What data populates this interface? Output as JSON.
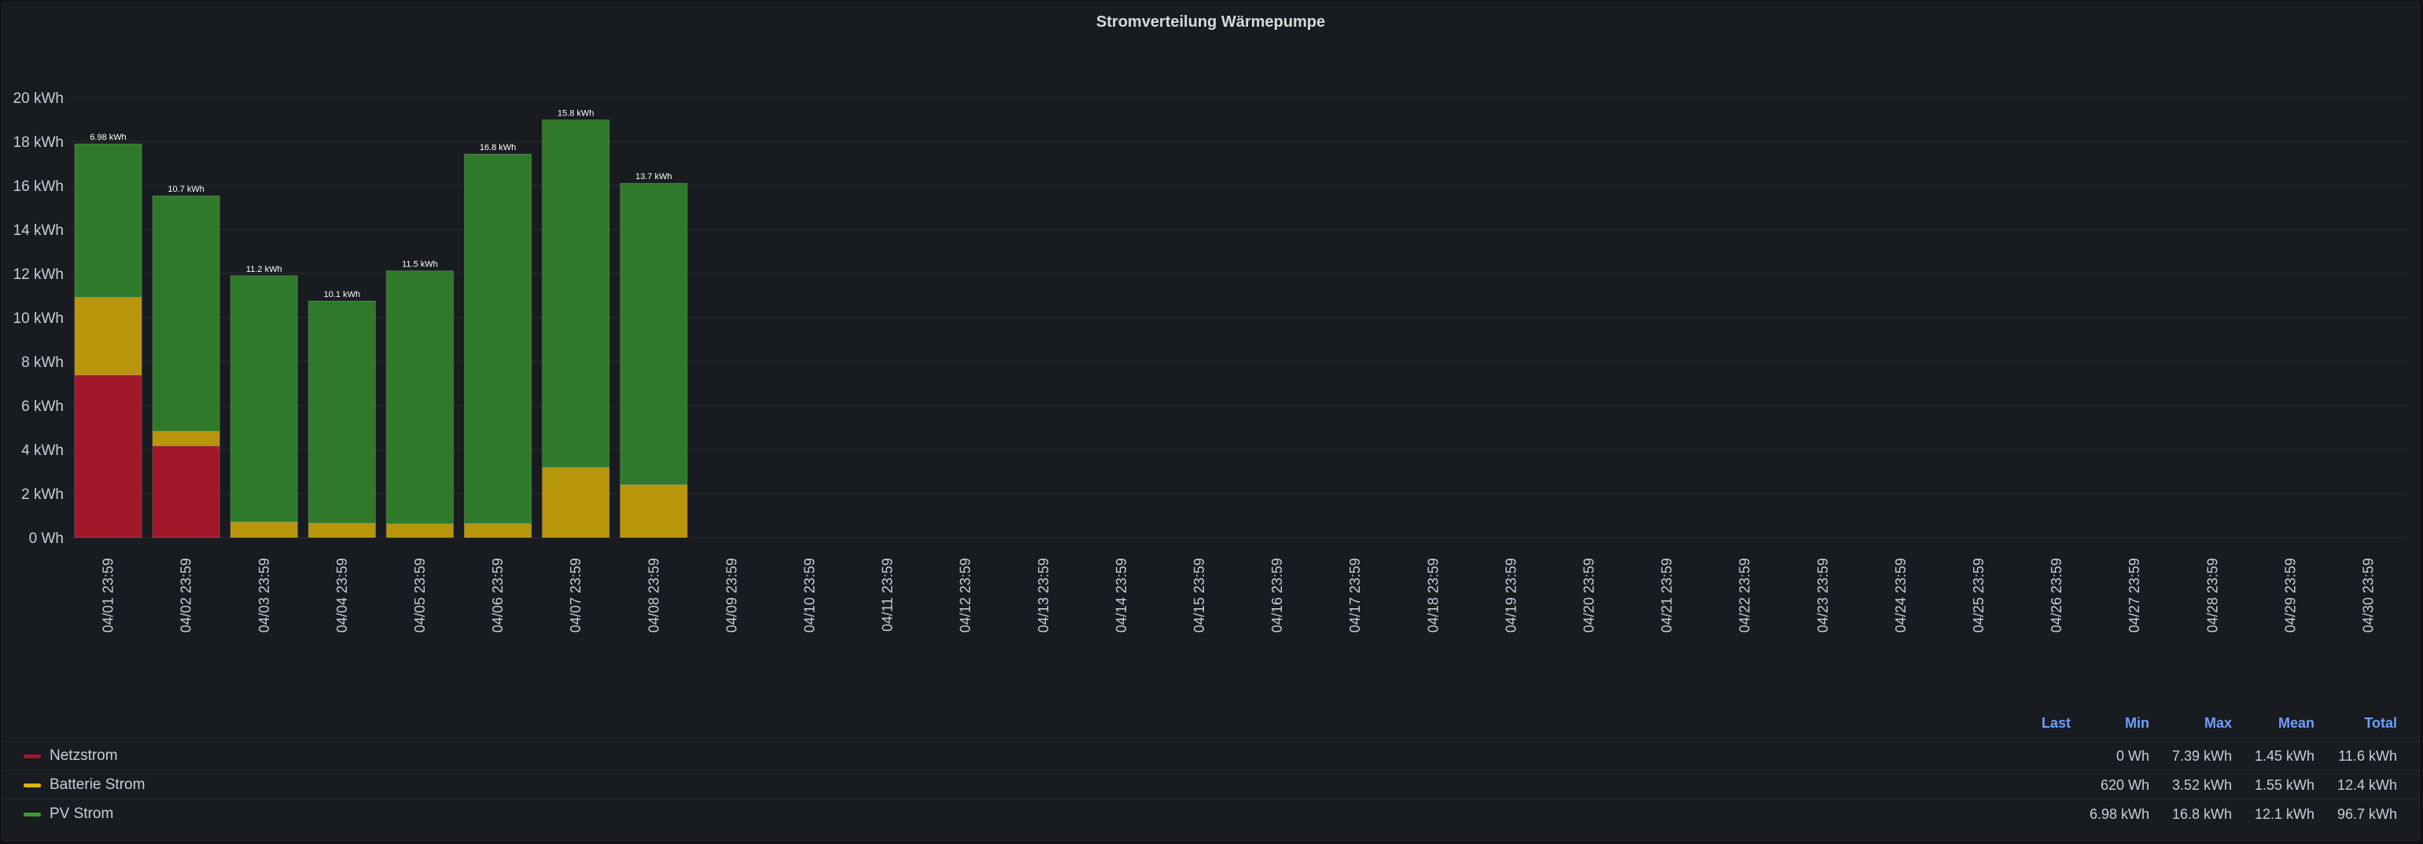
{
  "panel": {
    "title": "Stromverteilung Wärmepumpe"
  },
  "colors": {
    "netz": "#a0172a",
    "batterie": "#b8950a",
    "pv": "#2f7a2a",
    "grid": "#2a2d33",
    "text": "#ccccdc"
  },
  "chart_data": {
    "type": "bar",
    "stacked": true,
    "title": "Stromverteilung Wärmepumpe",
    "ylim": [
      0,
      20
    ],
    "yticks": [
      "0 Wh",
      "2 kWh",
      "4 kWh",
      "6 kWh",
      "8 kWh",
      "10 kWh",
      "12 kWh",
      "14 kWh",
      "16 kWh",
      "18 kWh",
      "20 kWh"
    ],
    "categories": [
      "04/01 23:59",
      "04/02 23:59",
      "04/03 23:59",
      "04/04 23:59",
      "04/05 23:59",
      "04/06 23:59",
      "04/07 23:59",
      "04/08 23:59",
      "04/09 23:59",
      "04/10 23:59",
      "04/11 23:59",
      "04/12 23:59",
      "04/13 23:59",
      "04/14 23:59",
      "04/15 23:59",
      "04/16 23:59",
      "04/17 23:59",
      "04/18 23:59",
      "04/19 23:59",
      "04/20 23:59",
      "04/21 23:59",
      "04/22 23:59",
      "04/23 23:59",
      "04/24 23:59",
      "04/25 23:59",
      "04/26 23:59",
      "04/27 23:59",
      "04/28 23:59",
      "04/29 23:59",
      "04/30 23:59"
    ],
    "series": [
      {
        "name": "Netzstrom",
        "color": "#a0172a",
        "values": [
          7.39,
          4.17,
          0,
          0,
          0,
          0,
          0,
          0
        ],
        "labels": [
          "7.39 kWh",
          "4.17 kWh",
          "0 Wh",
          "0 Wh",
          "0 Wh",
          "0 Wh",
          "0 Wh",
          "0 Wh"
        ]
      },
      {
        "name": "Batterie Strom",
        "color": "#b8950a",
        "values": [
          3.52,
          0.66,
          0.7,
          0.65,
          0.62,
          0.63,
          3.18,
          2.4
        ],
        "labels": [
          "3.52 kWh",
          "660 Wh",
          "700 Wh",
          "650 Wh",
          "620 Wh",
          "630 Wh",
          "3.18 kWh",
          "2.40 kWh"
        ]
      },
      {
        "name": "PV Strom",
        "color": "#2f7a2a",
        "values": [
          6.98,
          10.7,
          11.2,
          10.1,
          11.5,
          16.8,
          15.8,
          13.7
        ],
        "labels": [
          "6.98 kWh",
          "10.7 kWh",
          "11.2 kWh",
          "10.1 kWh",
          "11.5 kWh",
          "16.8 kWh",
          "15.8 kWh",
          "13.7 kWh"
        ]
      }
    ]
  },
  "legend": {
    "headers": [
      "Last",
      "Min",
      "Max",
      "Mean",
      "Total"
    ],
    "rows": [
      {
        "name": "Netzstrom",
        "color": "#a0172a",
        "last": "",
        "min": "0 Wh",
        "max": "7.39 kWh",
        "mean": "1.45 kWh",
        "total": "11.6 kWh"
      },
      {
        "name": "Batterie Strom",
        "color": "#e0b400",
        "last": "",
        "min": "620 Wh",
        "max": "3.52 kWh",
        "mean": "1.55 kWh",
        "total": "12.4 kWh"
      },
      {
        "name": "PV Strom",
        "color": "#3d9a35",
        "last": "",
        "min": "6.98 kWh",
        "max": "16.8 kWh",
        "mean": "12.1 kWh",
        "total": "96.7 kWh"
      }
    ]
  }
}
